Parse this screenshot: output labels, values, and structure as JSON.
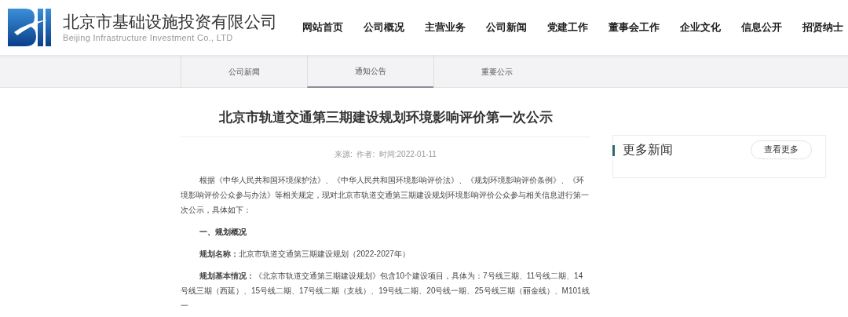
{
  "header": {
    "company_name": "北京市基础设施投资有限公司",
    "company_name_en": "Beijing Infrastructure Investment Co., LTD"
  },
  "nav": [
    {
      "label": "网站首页"
    },
    {
      "label": "公司概况"
    },
    {
      "label": "主营业务"
    },
    {
      "label": "公司新闻"
    },
    {
      "label": "党建工作"
    },
    {
      "label": "董事会工作"
    },
    {
      "label": "企业文化"
    },
    {
      "label": "信息公开"
    },
    {
      "label": "招贤纳士"
    }
  ],
  "subnav": [
    {
      "label": "公司新闻",
      "selected": false
    },
    {
      "label": "通知公告",
      "selected": true
    },
    {
      "label": "重要公示",
      "selected": false
    }
  ],
  "article": {
    "title": "北京市轨道交通第三期建设规划环境影响评价第一次公示",
    "meta": "来源:  作者:  时间:2022-01-11",
    "paragraphs": [
      {
        "kind": "text",
        "text": "根据《中华人民共和国环境保护法》、《中华人民共和国环境影响评价法》、《规划环境影响评价条例》、《环境影响评价公众参与办法》等相关规定，现对北京市轨道交通第三期建设规划环境影响评价公众参与相关信息进行第一次公示，具体如下："
      },
      {
        "kind": "heading",
        "text": "一、规划概况"
      },
      {
        "kind": "text",
        "text": "**规划名称：**北京市轨道交通第三期建设规划（2022-2027年）"
      },
      {
        "kind": "text",
        "text": "**规划基本情况：**《北京市轨道交通第三期建设规划》包含10个建设项目，具体为：7号线三期、11号线二期、14号线三期（西延）、15号线二期、17号线二期（支线）、19号线二期、20号线一期、25号线三期（丽金线）、M101线一"
      }
    ]
  },
  "sidebar": {
    "title": "更多新闻",
    "button": "查看更多"
  }
}
